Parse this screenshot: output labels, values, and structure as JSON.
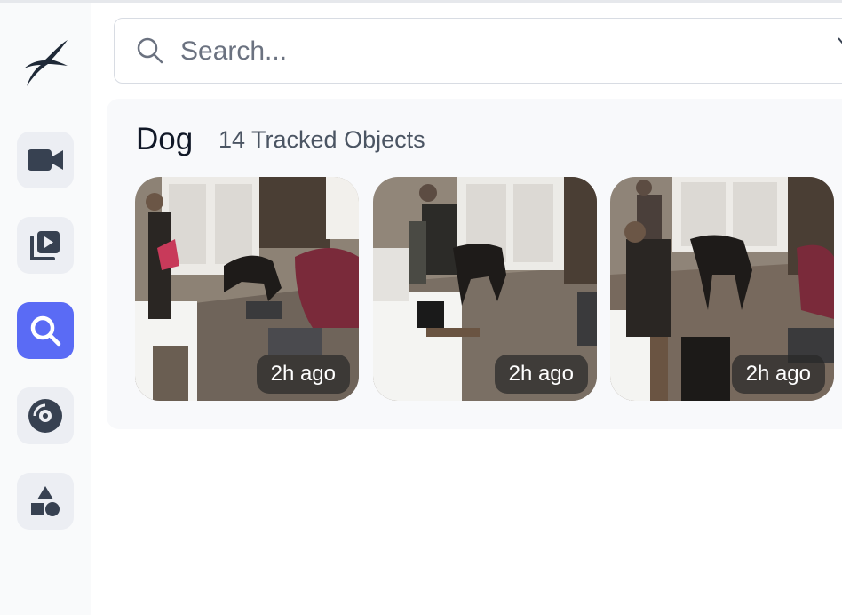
{
  "search": {
    "placeholder": "Search..."
  },
  "sidebar": {
    "items": [
      {
        "name": "cameras",
        "icon": "video-camera-icon",
        "active": false
      },
      {
        "name": "review",
        "icon": "play-library-icon",
        "active": false
      },
      {
        "name": "explore",
        "icon": "search-icon",
        "active": true
      },
      {
        "name": "recordings",
        "icon": "disc-icon",
        "active": false
      },
      {
        "name": "objects",
        "icon": "shapes-icon",
        "active": false
      }
    ]
  },
  "section": {
    "label": "Dog",
    "count_text": "14 Tracked Objects",
    "thumbnails": [
      {
        "time": "2h ago"
      },
      {
        "time": "2h ago"
      },
      {
        "time": "2h ago"
      }
    ]
  },
  "colors": {
    "accent": "#5a6bf5",
    "sidebar_bg": "#f9fafb",
    "button_bg": "#eceef3",
    "icon": "#374151"
  }
}
